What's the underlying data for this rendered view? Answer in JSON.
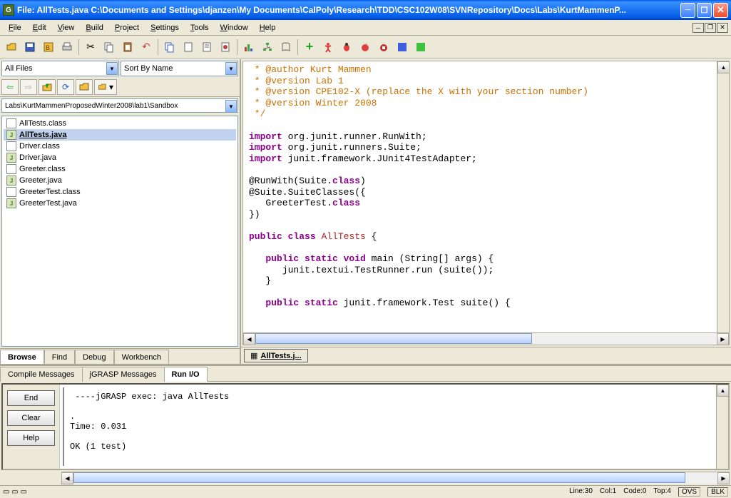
{
  "titlebar": {
    "app_icon_letter": "G",
    "title": "File:  AllTests.java  C:\\Documents and Settings\\djanzen\\My Documents\\CalPoly\\Research\\TDD\\CSC102W08\\SVNRepository\\Docs\\Labs\\KurtMammenP..."
  },
  "menu": {
    "items": [
      "File",
      "Edit",
      "View",
      "Build",
      "Project",
      "Settings",
      "Tools",
      "Window",
      "Help"
    ]
  },
  "left": {
    "filter_label": "All Files",
    "sort_label": "Sort By Name",
    "path": "Labs\\KurtMammenProposedWinter2008\\lab1\\Sandbox",
    "files": [
      {
        "name": "AllTests.class",
        "type": "class"
      },
      {
        "name": "AllTests.java",
        "type": "java",
        "selected": true
      },
      {
        "name": "Driver.class",
        "type": "class"
      },
      {
        "name": "Driver.java",
        "type": "java"
      },
      {
        "name": "Greeter.class",
        "type": "class"
      },
      {
        "name": "Greeter.java",
        "type": "java"
      },
      {
        "name": "GreeterTest.class",
        "type": "class"
      },
      {
        "name": "GreeterTest.java",
        "type": "java"
      }
    ],
    "tabs": [
      "Browse",
      "Find",
      "Debug",
      "Workbench"
    ],
    "active_tab": "Browse"
  },
  "editor": {
    "tab_label": "AllTests.j...",
    "code_lines": [
      {
        "type": "comment",
        "text": " * @author Kurt Mammen"
      },
      {
        "type": "comment",
        "text": " * @version Lab 1"
      },
      {
        "type": "comment",
        "text": " * @version CPE102-X (replace the X with your section number)"
      },
      {
        "type": "comment",
        "text": " * @version Winter 2008"
      },
      {
        "type": "comment",
        "text": " */"
      },
      {
        "type": "blank",
        "text": ""
      },
      {
        "type": "import",
        "text": "import org.junit.runner.RunWith;"
      },
      {
        "type": "import",
        "text": "import org.junit.runners.Suite;"
      },
      {
        "type": "import",
        "text": "import junit.framework.JUnit4TestAdapter;"
      },
      {
        "type": "blank",
        "text": ""
      },
      {
        "type": "ann",
        "text": "@RunWith(Suite.class)"
      },
      {
        "type": "ann2",
        "text": "@Suite.SuiteClasses({"
      },
      {
        "type": "annarg",
        "text": "   GreeterTest.class"
      },
      {
        "type": "plain",
        "text": "})"
      },
      {
        "type": "blank",
        "text": ""
      },
      {
        "type": "classdecl",
        "text": "public class AllTests {"
      },
      {
        "type": "blank",
        "text": ""
      },
      {
        "type": "method",
        "text": "   public static void main (String[] args) {"
      },
      {
        "type": "plain",
        "text": "      junit.textui.TestRunner.run (suite());"
      },
      {
        "type": "plain",
        "text": "   }"
      },
      {
        "type": "blank",
        "text": ""
      },
      {
        "type": "method2",
        "text": "   public static junit.framework.Test suite() {"
      }
    ]
  },
  "console": {
    "tabs": [
      "Compile Messages",
      "jGRASP Messages",
      "Run I/O"
    ],
    "active_tab": "Run I/O",
    "buttons": [
      "End",
      "Clear",
      "Help"
    ],
    "output": " ----jGRASP exec: java AllTests\n\n.\nTime: 0.031\n\nOK (1 test)\n"
  },
  "status": {
    "line": "Line:30",
    "col": "Col:1",
    "code": "Code:0",
    "top": "Top:4",
    "ovs": "OVS",
    "blk": "BLK"
  }
}
